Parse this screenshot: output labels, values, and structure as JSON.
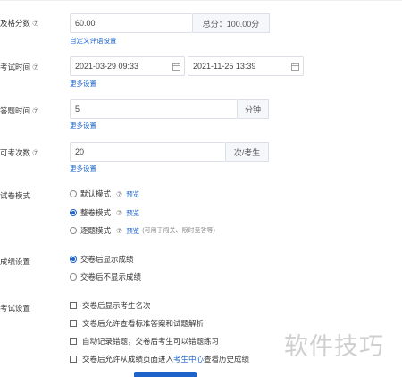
{
  "rows": {
    "pass_score": {
      "label": "及格分数",
      "help": "⑦",
      "value": "60.00",
      "suffix": "总分：100.00分",
      "link": "自定义评语设置"
    },
    "exam_time": {
      "label": "考试时间",
      "help": "⑦",
      "start": "2021-03-29 09:33",
      "end": "2021-11-25 13:39",
      "link": "更多设置"
    },
    "answer_time": {
      "label": "答题时间",
      "help": "⑦",
      "value": "5",
      "suffix": "分钟",
      "link": "更多设置"
    },
    "attempts": {
      "label": "可考次数",
      "help": "⑦",
      "value": "20",
      "suffix": "次/考生",
      "link": "更多设置"
    }
  },
  "paper_mode": {
    "label": "试卷模式",
    "help": "",
    "options": [
      {
        "label": "默认模式",
        "help": "⑦",
        "preview": "预览",
        "note": "",
        "selected": false
      },
      {
        "label": "整卷模式",
        "help": "⑦",
        "preview": "预览",
        "note": "",
        "selected": true
      },
      {
        "label": "逐题模式",
        "help": "⑦",
        "preview": "预览",
        "note": "(可用于闯关、限时竞答等)",
        "selected": false
      }
    ]
  },
  "score_setting": {
    "label": "成绩设置",
    "options": [
      {
        "label": "交卷后显示成绩",
        "selected": true
      },
      {
        "label": "交卷后不显示成绩",
        "selected": false
      }
    ]
  },
  "exam_setting": {
    "label": "考试设置",
    "options": [
      {
        "parts": [
          "交卷后显示考生名次"
        ],
        "checked": false
      },
      {
        "parts": [
          "交卷后允许查看标准答案和试题解析"
        ],
        "checked": false
      },
      {
        "parts": [
          "自动记录错题，交卷后考生可以错题练习"
        ],
        "checked": false
      },
      {
        "parts": [
          "交卷后允许从成绩页面进入",
          "考生中心",
          "查看历史成绩"
        ],
        "checked": false
      }
    ]
  },
  "watermark": "软件技巧",
  "colors": {
    "accent": "#1d63c9",
    "border": "#dcdfe6",
    "suffix_bg": "#f5f7fa"
  },
  "icons": {
    "date": "calendar-icon",
    "help": "question-circle-icon"
  }
}
